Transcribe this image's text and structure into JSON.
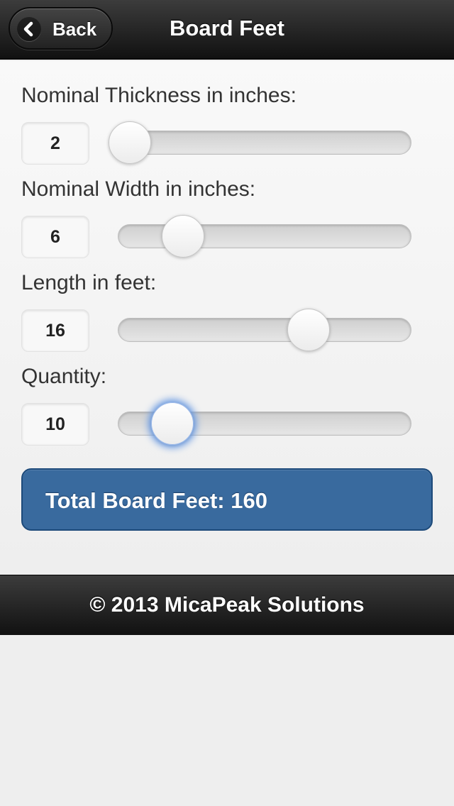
{
  "header": {
    "back_label": "Back",
    "title": "Board Feet"
  },
  "fields": [
    {
      "label": "Nominal Thickness in inches:",
      "value": "2",
      "slider_fraction": 0.04
    },
    {
      "label": "Nominal Width in inches:",
      "value": "6",
      "slider_fraction": 0.22
    },
    {
      "label": "Length in feet:",
      "value": "16",
      "slider_fraction": 0.65
    },
    {
      "label": "Quantity:",
      "value": "10",
      "slider_fraction": 0.185
    }
  ],
  "result": {
    "total_text": "Total Board Feet: 160"
  },
  "footer": {
    "text": "© 2013 MicaPeak Solutions"
  },
  "colors": {
    "accent": "#396a9e",
    "bar": "#1a1a1a",
    "focus_glow": "#6a9be3"
  },
  "icons": {
    "back": "chevron-left-icon"
  }
}
